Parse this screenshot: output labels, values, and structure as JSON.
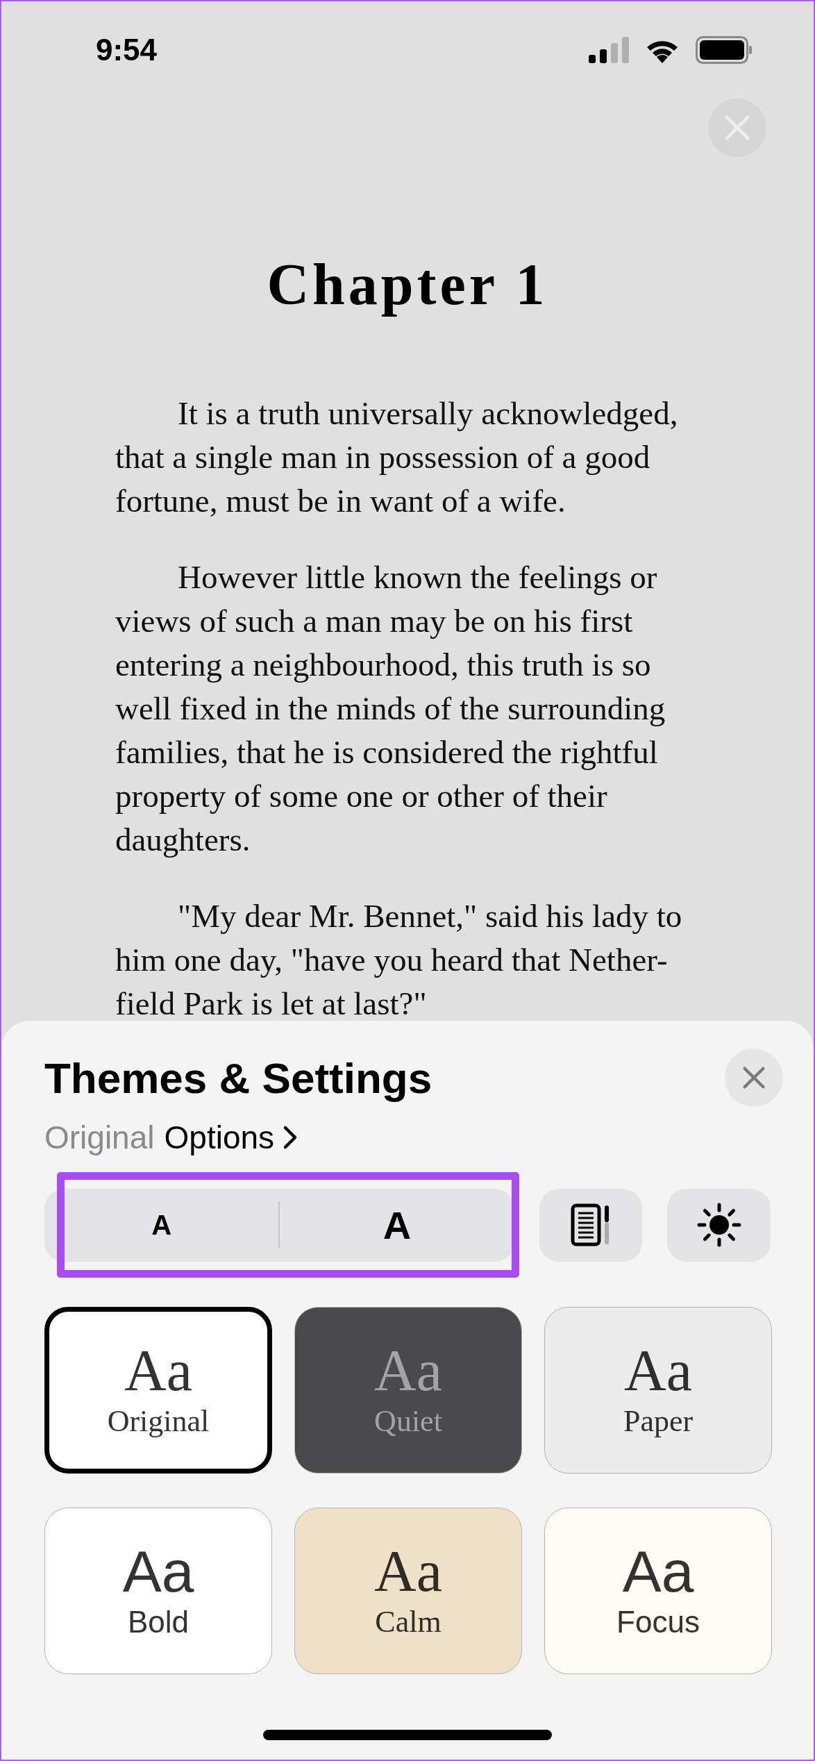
{
  "status_bar": {
    "time": "9:54"
  },
  "reader": {
    "chapter_title": "Chapter 1",
    "paragraphs": [
      {
        "lines": [
          "It is a truth universally acknowledged,",
          "that a single man in possession of a good",
          "fortune, must be in want of a wife."
        ]
      },
      {
        "lines": [
          "However little known the feelings or",
          "views of such a man may be on his first",
          "entering a neighbourhood, this truth is so",
          "well fixed in the minds of the surrounding",
          "families, that he is considered the rightful",
          "property of some one or other of their",
          "daughters."
        ]
      },
      {
        "lines": [
          "\"My dear Mr. Bennet,\" said his lady to",
          "him one day, \"have you heard that Nether-",
          "field Park is let at last?\""
        ]
      }
    ]
  },
  "sheet": {
    "title": "Themes & Settings",
    "theme_name": "Original",
    "options_label": "Options",
    "font_size": {
      "smaller": "A",
      "larger": "A",
      "highlighted": true
    },
    "themes": [
      {
        "name": "Original",
        "sample": "Aa",
        "kind": "serif",
        "color": "#ffffff",
        "selected": true
      },
      {
        "name": "Quiet",
        "sample": "Aa",
        "kind": "serif",
        "color": "#4a4a4c",
        "selected": false
      },
      {
        "name": "Paper",
        "sample": "Aa",
        "kind": "serif",
        "color": "#ececec",
        "selected": false
      },
      {
        "name": "Bold",
        "sample": "Aa",
        "kind": "sans",
        "color": "#ffffff",
        "selected": false
      },
      {
        "name": "Calm",
        "sample": "Aa",
        "kind": "serif",
        "color": "#efe1c7",
        "selected": false
      },
      {
        "name": "Focus",
        "sample": "Aa",
        "kind": "sans",
        "color": "#fffcf4",
        "selected": false
      }
    ]
  }
}
